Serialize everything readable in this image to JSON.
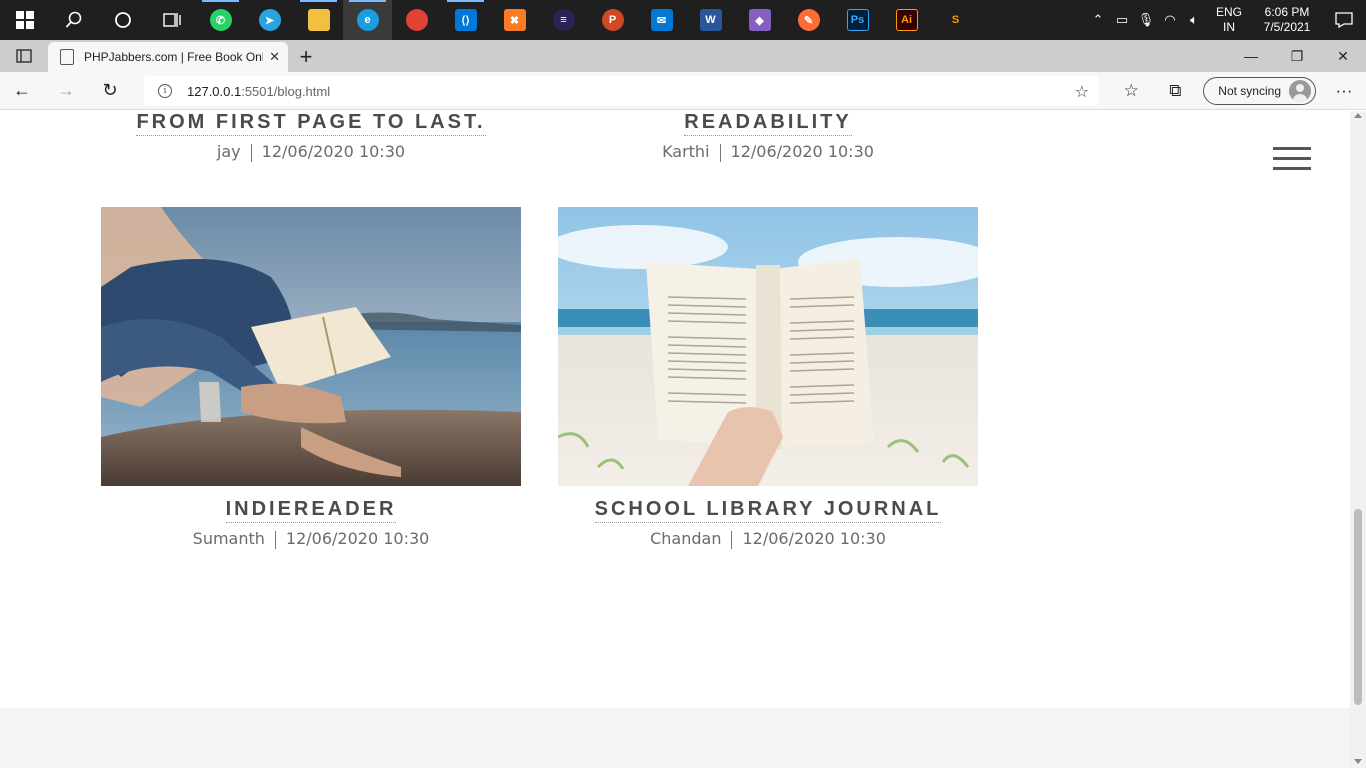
{
  "taskbar": {
    "apps": [
      {
        "name": "whatsapp",
        "glyph": "✆",
        "color": "#25d366"
      },
      {
        "name": "telegram",
        "glyph": "➤",
        "color": "#2aa3df"
      },
      {
        "name": "file-explorer",
        "glyph": "",
        "color": "#f2c040"
      },
      {
        "name": "edge",
        "glyph": "e",
        "color": "#1b9de2"
      },
      {
        "name": "chrome",
        "glyph": "",
        "color": "#e34133"
      },
      {
        "name": "vscode",
        "glyph": "⟨⟩",
        "color": "#0078d7"
      },
      {
        "name": "xampp",
        "glyph": "✖",
        "color": "#fb7a24"
      },
      {
        "name": "eclipse",
        "glyph": "≡",
        "color": "#2c2255"
      },
      {
        "name": "powerpoint",
        "glyph": "P",
        "color": "#d24726"
      },
      {
        "name": "mail",
        "glyph": "✉",
        "color": "#0078d4"
      },
      {
        "name": "word",
        "glyph": "W",
        "color": "#2b579a"
      },
      {
        "name": "visual-studio",
        "glyph": "◆",
        "color": "#865fc5"
      },
      {
        "name": "postman",
        "glyph": "✎",
        "color": "#ff6c37"
      },
      {
        "name": "photoshop",
        "glyph": "Ps",
        "color": "#001e36"
      },
      {
        "name": "illustrator",
        "glyph": "Ai",
        "color": "#330000"
      },
      {
        "name": "sublime",
        "glyph": "S",
        "color": "#4a4a4a"
      }
    ],
    "lang_top": "ENG",
    "lang_bottom": "IN",
    "time": "6:06 PM",
    "date": "7/5/2021"
  },
  "browser": {
    "tab_title": "PHPJabbers.com | Free Book Online",
    "url_host": "127.0.0.1",
    "url_rest": ":5501/blog.html",
    "sync_label": "Not syncing"
  },
  "posts_top": [
    {
      "title": "From first page to last.",
      "author": "jay",
      "date": "12/06/2020 10:30"
    },
    {
      "title": "Readability",
      "author": "Karthi",
      "date": "12/06/2020 10:30"
    }
  ],
  "posts": [
    {
      "title": "Indiereader",
      "author": "Sumanth",
      "date": "12/06/2020 10:30",
      "image": "woman-reading-by-water"
    },
    {
      "title": "School Library Journal",
      "author": "Chandan",
      "date": "12/06/2020 10:30",
      "image": "open-book-on-beach"
    }
  ]
}
